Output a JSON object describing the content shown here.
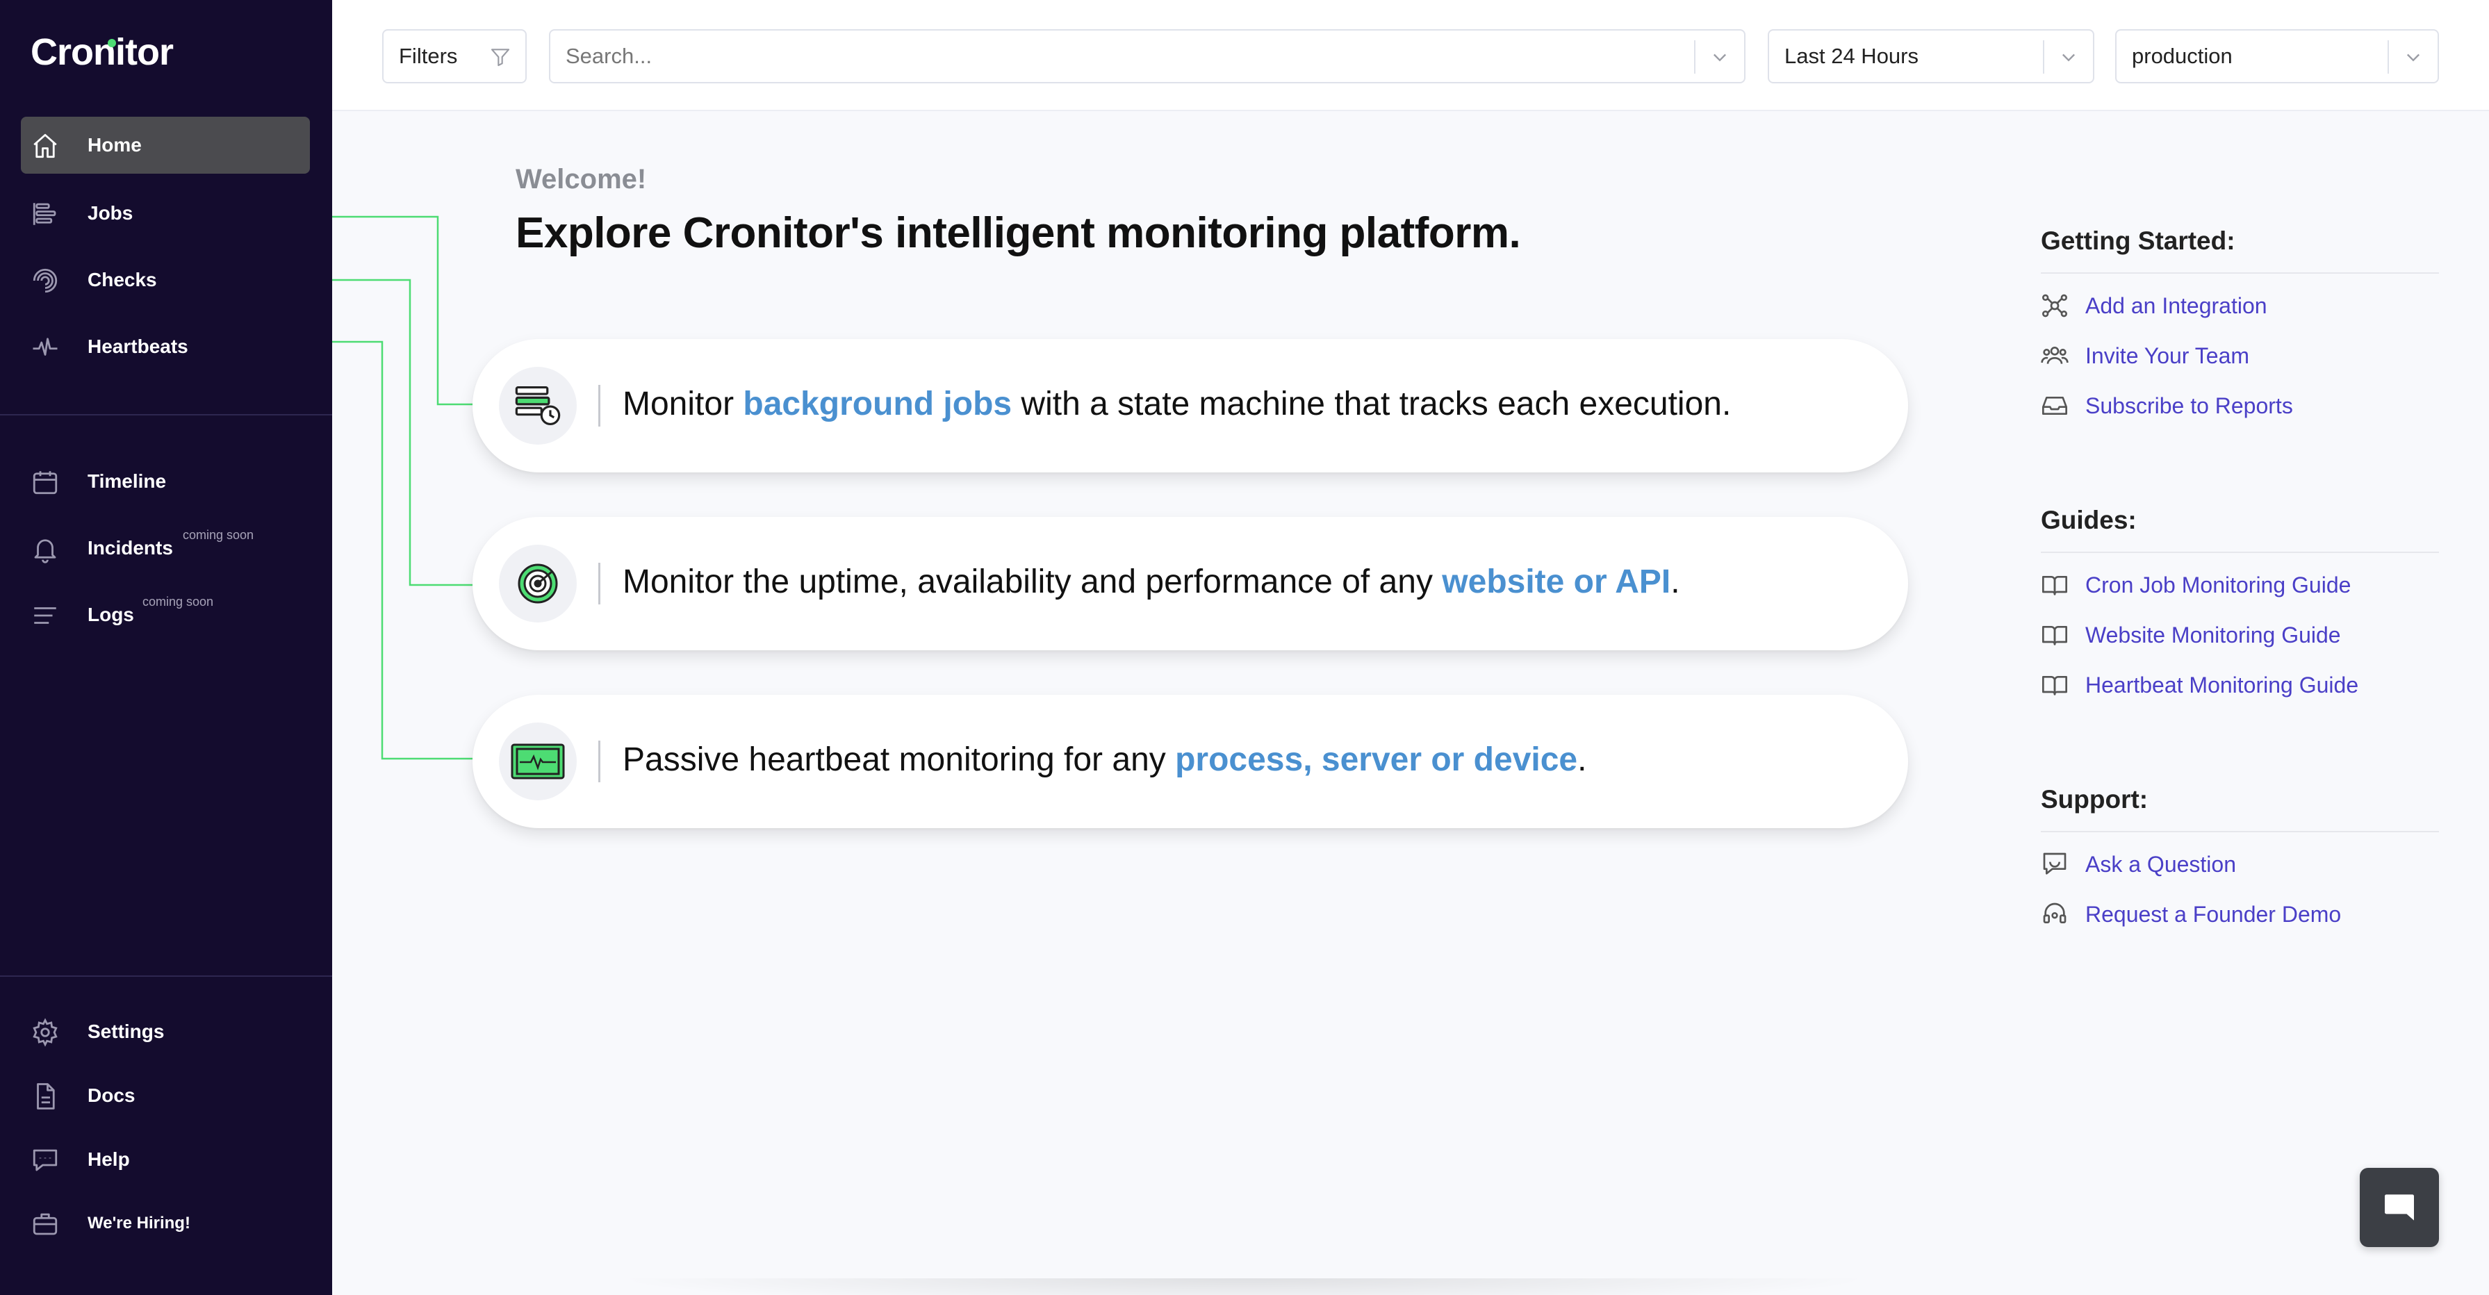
{
  "brand": {
    "name": "Cronitor",
    "accent": "#4ddc73"
  },
  "sidebar": {
    "primary": [
      {
        "label": "Home",
        "icon": "home-icon",
        "active": true
      },
      {
        "label": "Jobs",
        "icon": "jobs-icon"
      },
      {
        "label": "Checks",
        "icon": "checks-icon"
      },
      {
        "label": "Heartbeats",
        "icon": "heartbeats-icon"
      }
    ],
    "secondary": [
      {
        "label": "Timeline",
        "icon": "calendar-icon"
      },
      {
        "label": "Incidents",
        "icon": "bell-icon",
        "badge": "coming soon"
      },
      {
        "label": "Logs",
        "icon": "logs-icon",
        "badge": "coming soon"
      }
    ],
    "footer": [
      {
        "label": "Settings",
        "icon": "gear-icon"
      },
      {
        "label": "Docs",
        "icon": "document-icon"
      },
      {
        "label": "Help",
        "icon": "help-chat-icon"
      },
      {
        "label": "We're Hiring!",
        "icon": "briefcase-icon"
      }
    ]
  },
  "topbar": {
    "filters_label": "Filters",
    "search_placeholder": "Search...",
    "time_range": "Last 24 Hours",
    "environment": "production"
  },
  "main": {
    "welcome": "Welcome!",
    "headline": "Explore Cronitor's intelligent monitoring platform.",
    "cards": [
      {
        "pre": "Monitor ",
        "link": "background jobs",
        "post": " with a state machine that tracks each execution.",
        "icon": "background-jobs-icon"
      },
      {
        "pre": "Monitor the uptime, availability and performance of any ",
        "link": "website or API",
        "post": ".",
        "icon": "radar-icon"
      },
      {
        "pre": "Passive heartbeat monitoring for any ",
        "link": "process, server or device",
        "post": ".",
        "icon": "heartbeat-monitor-icon"
      }
    ]
  },
  "right_panel": {
    "getting_started": {
      "title": "Getting Started:",
      "links": [
        {
          "label": "Add an Integration",
          "icon": "integration-icon"
        },
        {
          "label": "Invite Your Team",
          "icon": "team-icon"
        },
        {
          "label": "Subscribe to Reports",
          "icon": "inbox-icon"
        }
      ]
    },
    "guides": {
      "title": "Guides:",
      "links": [
        {
          "label": "Cron Job Monitoring Guide",
          "icon": "book-icon"
        },
        {
          "label": "Website Monitoring Guide",
          "icon": "book-icon"
        },
        {
          "label": "Heartbeat Monitoring Guide",
          "icon": "book-icon"
        }
      ]
    },
    "support": {
      "title": "Support:",
      "links": [
        {
          "label": "Ask a Question",
          "icon": "question-chat-icon"
        },
        {
          "label": "Request a Founder Demo",
          "icon": "headset-icon"
        }
      ]
    }
  },
  "colors": {
    "sidebar_bg": "#140c2e",
    "link": "#4a3fc7",
    "highlight": "#4a90d0",
    "connector": "#4ddc73"
  }
}
